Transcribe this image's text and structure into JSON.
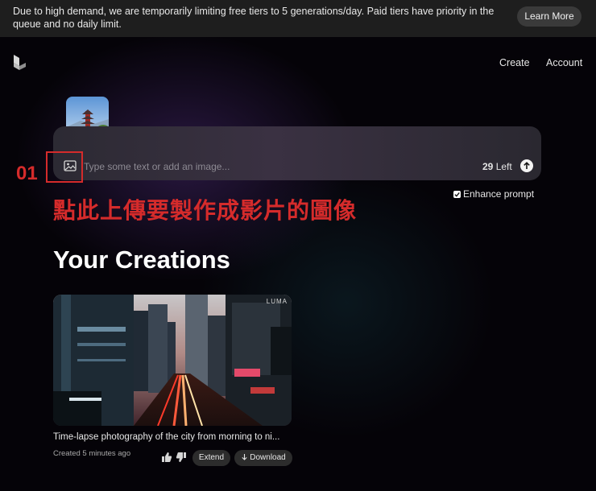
{
  "banner": {
    "text": "Due to high demand, we are temporarily limiting free tiers to 5 generations/day. Paid tiers have priority in the queue and no daily limit.",
    "learn_more_label": "Learn More"
  },
  "nav": {
    "logo": "luma-logo-icon",
    "create_label": "Create",
    "account_label": "Account"
  },
  "prompt": {
    "placeholder": "Type some text or add an image...",
    "remaining_count": "29",
    "remaining_suffix": " Left",
    "enhance_label": "Enhance prompt",
    "enhance_checked": true,
    "image_icon": "image-icon",
    "send_icon": "arrow-up-icon"
  },
  "annotation": {
    "number": "01",
    "text": "點此上傳要製作成影片的圖像",
    "color": "#d52b2b"
  },
  "creations": {
    "title": "Your Creations",
    "items": [
      {
        "title": "Time-lapse photography of the city from morning to ni...",
        "meta": "Created 5 minutes ago",
        "watermark": "LUMA",
        "extend_label": "Extend",
        "download_label": "Download"
      }
    ]
  }
}
